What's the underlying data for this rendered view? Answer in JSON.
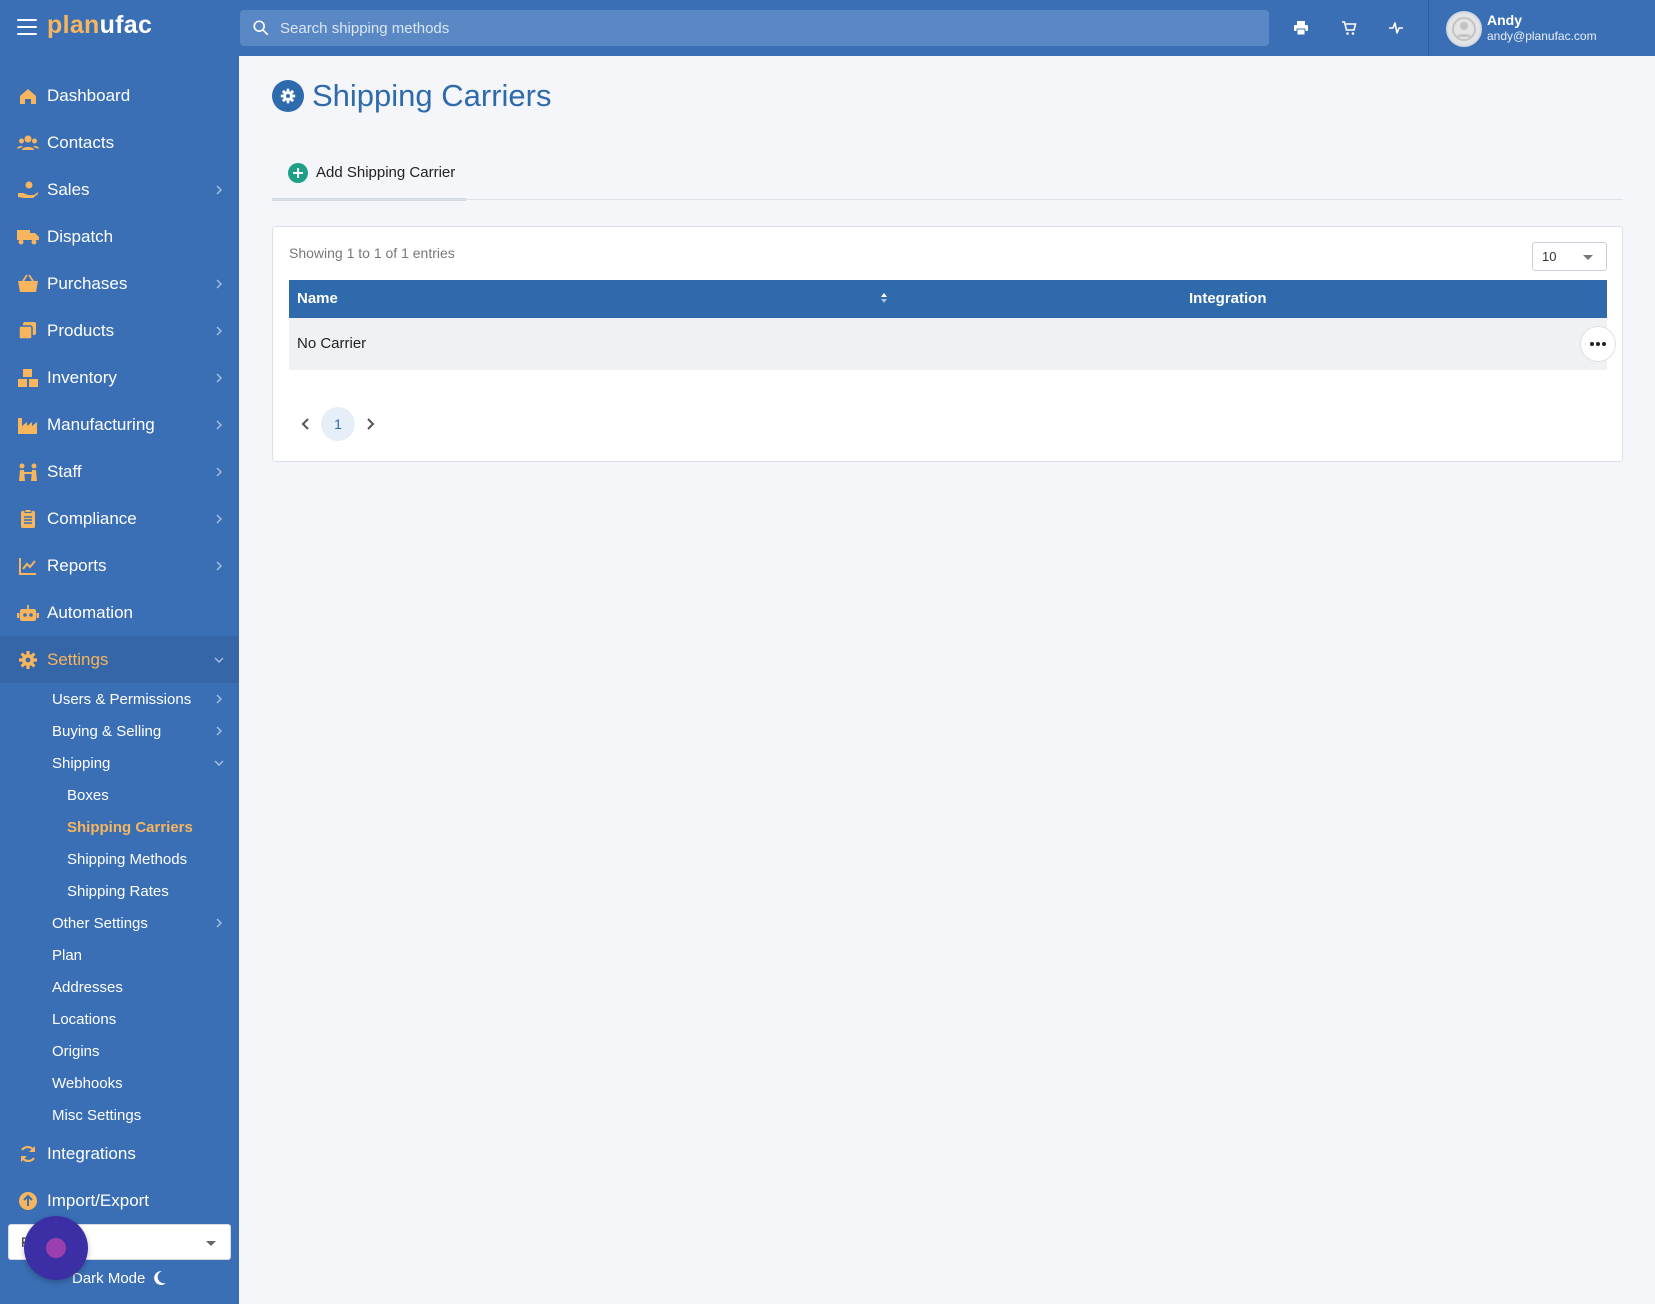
{
  "app": {
    "logo_a": "plan",
    "logo_b": "ufac"
  },
  "search": {
    "placeholder": "Search shipping methods"
  },
  "topbar": {
    "icons": [
      "printer-icon",
      "cart-icon",
      "activity-icon"
    ]
  },
  "user": {
    "name": "Andy",
    "email": "andy@planufac.com"
  },
  "sidebar": {
    "items": [
      {
        "label": "Dashboard",
        "icon": "home-icon",
        "has_children": false
      },
      {
        "label": "Contacts",
        "icon": "users-icon",
        "has_children": false
      },
      {
        "label": "Sales",
        "icon": "hand-coin-icon",
        "has_children": true
      },
      {
        "label": "Dispatch",
        "icon": "truck-icon",
        "has_children": false
      },
      {
        "label": "Purchases",
        "icon": "basket-icon",
        "has_children": true
      },
      {
        "label": "Products",
        "icon": "copy-icon",
        "has_children": true
      },
      {
        "label": "Inventory",
        "icon": "boxes-icon",
        "has_children": true
      },
      {
        "label": "Manufacturing",
        "icon": "factory-icon",
        "has_children": true
      },
      {
        "label": "Staff",
        "icon": "people-icon",
        "has_children": true
      },
      {
        "label": "Compliance",
        "icon": "clipboard-icon",
        "has_children": true
      },
      {
        "label": "Reports",
        "icon": "chart-line-icon",
        "has_children": true
      },
      {
        "label": "Automation",
        "icon": "robot-icon",
        "has_children": false
      },
      {
        "label": "Settings",
        "icon": "gear-icon",
        "has_children": true,
        "expanded": true
      }
    ],
    "settings_children": [
      {
        "label": "Users & Permissions",
        "has_children": true
      },
      {
        "label": "Buying & Selling",
        "has_children": true
      },
      {
        "label": "Shipping",
        "has_children": true,
        "expanded": true
      },
      {
        "label": "Boxes",
        "level": 2
      },
      {
        "label": "Shipping Carriers",
        "level": 2,
        "current": true
      },
      {
        "label": "Shipping Methods",
        "level": 2
      },
      {
        "label": "Shipping Rates",
        "level": 2
      },
      {
        "label": "Other Settings",
        "has_children": true
      },
      {
        "label": "Plan"
      },
      {
        "label": "Addresses"
      },
      {
        "label": "Locations"
      },
      {
        "label": "Origins"
      },
      {
        "label": "Webhooks"
      },
      {
        "label": "Misc Settings"
      }
    ],
    "bottom_items": [
      {
        "label": "Integrations",
        "icon": "sync-icon"
      },
      {
        "label": "Import/Export",
        "icon": "upload-icon"
      }
    ],
    "select_value": "F",
    "dark_mode_label": "Dark Mode"
  },
  "colors": {
    "primary": "#3a6fb5",
    "primary_dark": "#2f6aad",
    "accent": "#f7b55d",
    "add_green": "#1ea087",
    "background": "#f4f6f9"
  },
  "page": {
    "title": "Shipping Carriers",
    "tab_label": "Add Shipping Carrier"
  },
  "table": {
    "entries_text": "Showing 1 to 1 of 1 entries",
    "page_size": "10",
    "columns": [
      "Name",
      "Integration"
    ],
    "rows": [
      {
        "name": "No Carrier",
        "integration": ""
      }
    ],
    "current_page": "1"
  }
}
